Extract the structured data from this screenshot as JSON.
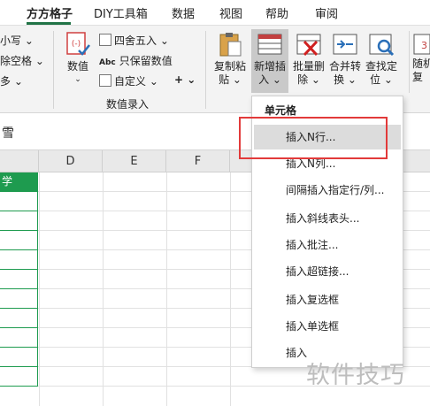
{
  "tabs": [
    "方方格子",
    "DIY工具箱",
    "数据",
    "视图",
    "帮助",
    "审阅"
  ],
  "ribbon": {
    "left_partial": [
      "小写 ⌄",
      "除空格 ⌄",
      "多 ⌄"
    ],
    "numeric_btn": "数值",
    "round_btn": "四舍五入",
    "keep_values_btn": "只保留数值",
    "custom_btn": "自定义",
    "plus_label": "+ ⌄",
    "group_label": "数值录入",
    "copy_paste_btn": [
      "复制粘",
      "贴 ⌄"
    ],
    "insert_btn": [
      "新增插",
      "入 ⌄"
    ],
    "batch_delete_btn": [
      "批量删",
      "除 ⌄"
    ],
    "merge_btn": [
      "合并转",
      "换 ⌄"
    ],
    "find_btn": [
      "查找定",
      "位 ⌄"
    ],
    "random_btn": [
      "随机",
      "复"
    ],
    "abc_label": "Abc",
    "num_label": "3"
  },
  "formula_bar": {
    "value": "雪"
  },
  "columns": [
    "D",
    "E",
    "F"
  ],
  "green_header": "学",
  "menu": {
    "title": "单元格",
    "items": [
      "插入N行...",
      "插入N列...",
      "间隔插入指定行/列...",
      "插入斜线表头...",
      "插入批注...",
      "插入超链接...",
      "插入复选框",
      "插入单选框",
      "插入"
    ]
  },
  "watermark": "软件技巧",
  "colors": {
    "accent": "#217346",
    "green": "#1e9b4f",
    "highlight_box": "#e23a3a"
  }
}
